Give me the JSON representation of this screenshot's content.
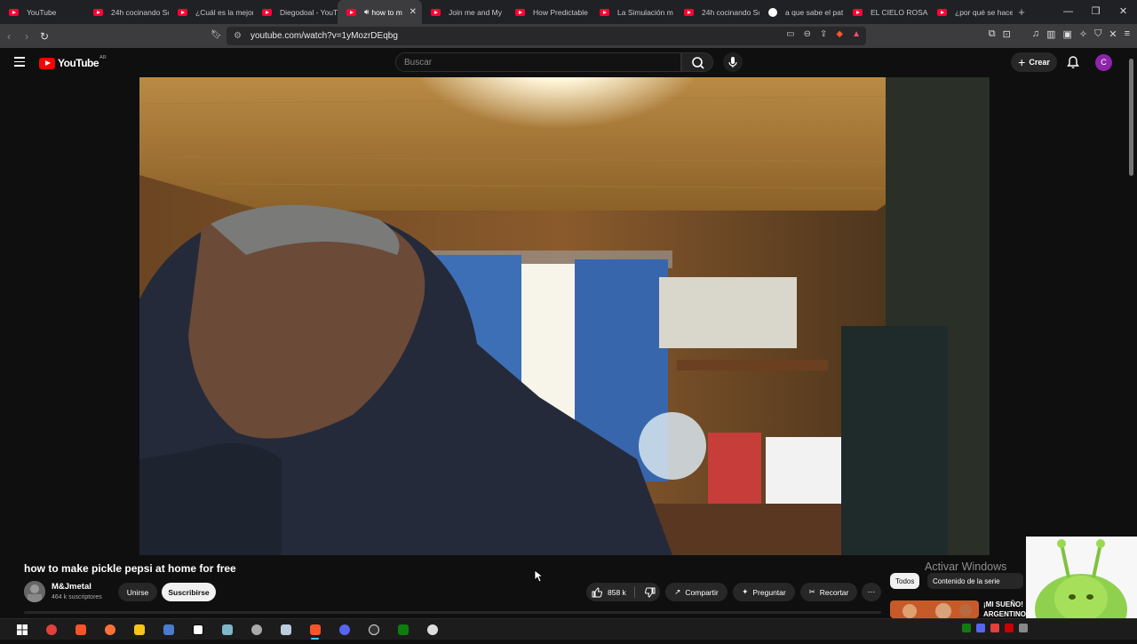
{
  "browser": {
    "tabs": [
      {
        "label": "YouTube",
        "icon": "youtube-icon"
      },
      {
        "label": "24h cocinando Sc",
        "icon": "youtube-icon"
      },
      {
        "label": "¿Cuál es la mejor",
        "icon": "youtube-icon"
      },
      {
        "label": "Diegodoal - YouT",
        "icon": "youtube-icon"
      },
      {
        "label": "how to m",
        "icon": "youtube-icon",
        "active": true
      },
      {
        "label": "Join me and My",
        "icon": "youtube-icon"
      },
      {
        "label": "How Predictable",
        "icon": "youtube-icon"
      },
      {
        "label": "La Simulación m",
        "icon": "youtube-icon"
      },
      {
        "label": "24h cocinando Sc",
        "icon": "youtube-icon"
      },
      {
        "label": "a que sabe el pat",
        "icon": "google-icon"
      },
      {
        "label": "EL CIELO ROSADO",
        "icon": "youtube-icon"
      },
      {
        "label": "¿por qué se hace",
        "icon": "youtube-icon"
      }
    ],
    "url": "youtube.com/watch?v=1yMozrDEqbg"
  },
  "youtube": {
    "logo_text": "YouTube",
    "country_code": "AR",
    "search_placeholder": "Buscar",
    "create_label": "Crear",
    "avatar_letter": "C"
  },
  "video": {
    "title": "how to make pickle pepsi at home for free",
    "channel_name": "M&Jmetal",
    "subscribers": "464 k suscriptores",
    "join_label": "Unirse",
    "subscribe_label": "Suscribirse",
    "likes": "858 k",
    "share_label": "Compartir",
    "ask_label": "Preguntar",
    "clip_label": "Recortar"
  },
  "sidebar": {
    "chip_all": "Todos",
    "chip_series": "Contenido de la serie",
    "rec_title": "¡MI SUEÑO! ARGENTINO"
  },
  "overlay": {
    "activate_windows": "Activar Windows"
  },
  "colors": {
    "accent_red": "#ff0000",
    "background": "#0f0f0f",
    "avatar": "#8e24aa"
  }
}
